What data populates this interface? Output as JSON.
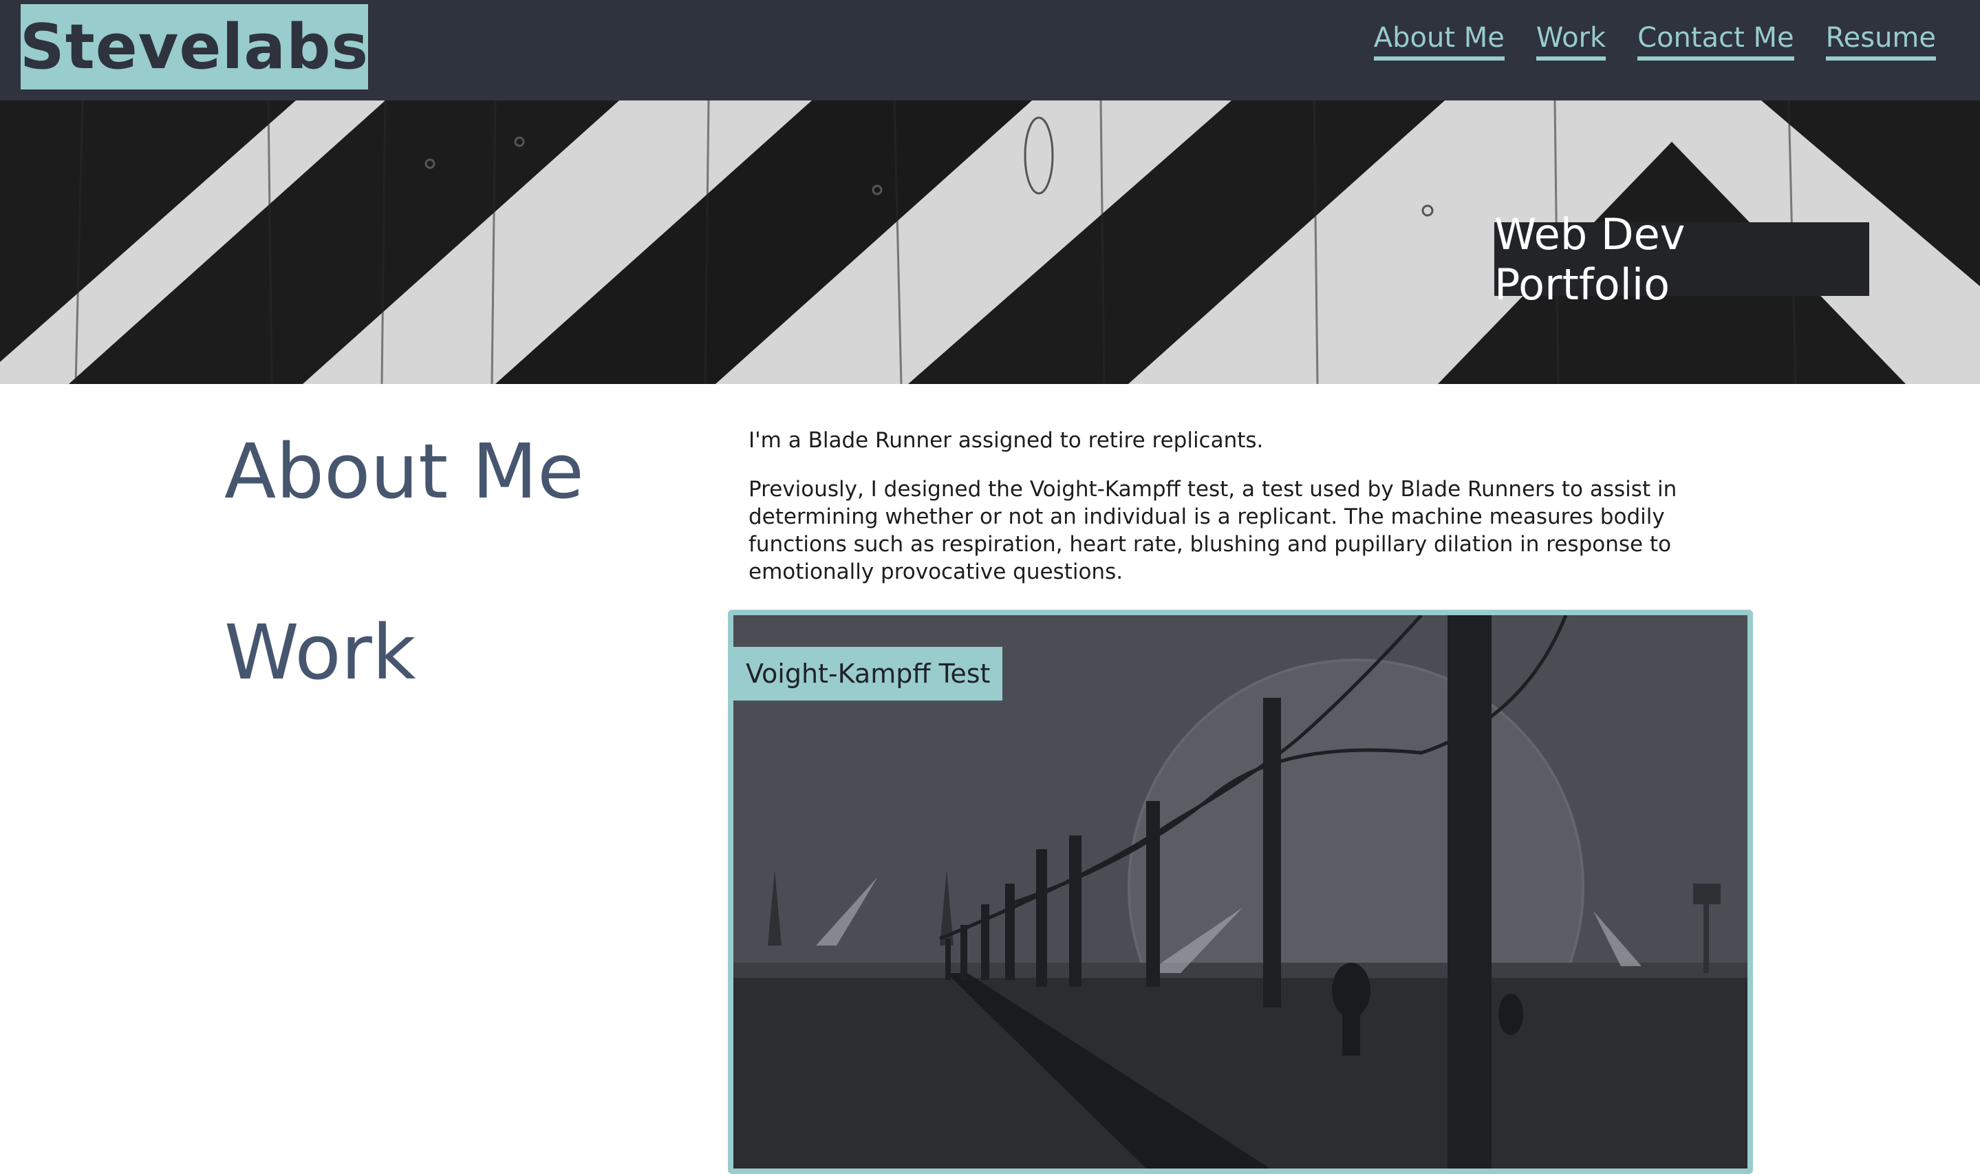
{
  "header": {
    "logo": "Stevelabs",
    "nav": [
      {
        "label": "About Me"
      },
      {
        "label": "Work"
      },
      {
        "label": "Contact Me"
      },
      {
        "label": "Resume"
      }
    ]
  },
  "hero": {
    "title": "Web Dev Portfolio"
  },
  "about": {
    "heading": "About Me",
    "paragraphs": [
      "I'm a Blade Runner assigned to retire replicants.",
      "Previously, I designed the Voight-Kampff test, a test used by Blade Runners to assist in determining whether or not an individual is a replicant. The machine measures bodily functions such as respiration, heart rate, blushing and pupillary dilation in response to emotionally provocative questions."
    ]
  },
  "work": {
    "heading": "Work",
    "projects": [
      {
        "title": "Voight-Kampff Test"
      }
    ]
  },
  "colors": {
    "header_bg": "#2f333e",
    "accent": "#99cccc",
    "heading": "#47566f"
  }
}
